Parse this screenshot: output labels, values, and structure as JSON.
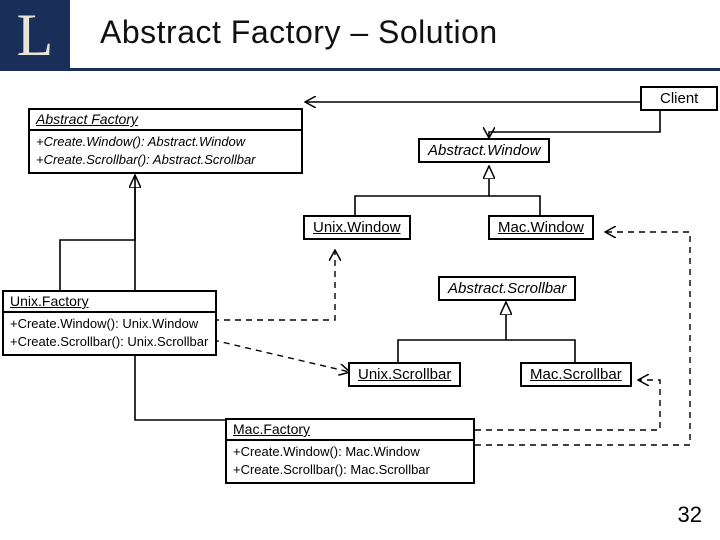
{
  "slide": {
    "title": "Abstract Factory – Solution",
    "logo_glyph": "L",
    "page_number": "32"
  },
  "classes": {
    "abstract_factory": {
      "name": "Abstract Factory",
      "op1": "+Create.Window(): Abstract.Window",
      "op2": "+Create.Scrollbar(): Abstract.Scrollbar"
    },
    "client": {
      "name": "Client"
    },
    "abstract_window": {
      "name": "Abstract.Window"
    },
    "unix_window": {
      "name": "Unix.Window"
    },
    "mac_window": {
      "name": "Mac.Window"
    },
    "abstract_scrollbar": {
      "name": "Abstract.Scrollbar"
    },
    "unix_factory": {
      "name": "Unix.Factory",
      "op1": "+Create.Window(): Unix.Window",
      "op2": "+Create.Scrollbar(): Unix.Scrollbar"
    },
    "unix_scrollbar": {
      "name": "Unix.Scrollbar"
    },
    "mac_scrollbar": {
      "name": "Mac.Scrollbar"
    },
    "mac_factory": {
      "name": "Mac.Factory",
      "op1": "+Create.Window(): Mac.Window",
      "op2": "+Create.Scrollbar(): Mac.Scrollbar"
    }
  }
}
